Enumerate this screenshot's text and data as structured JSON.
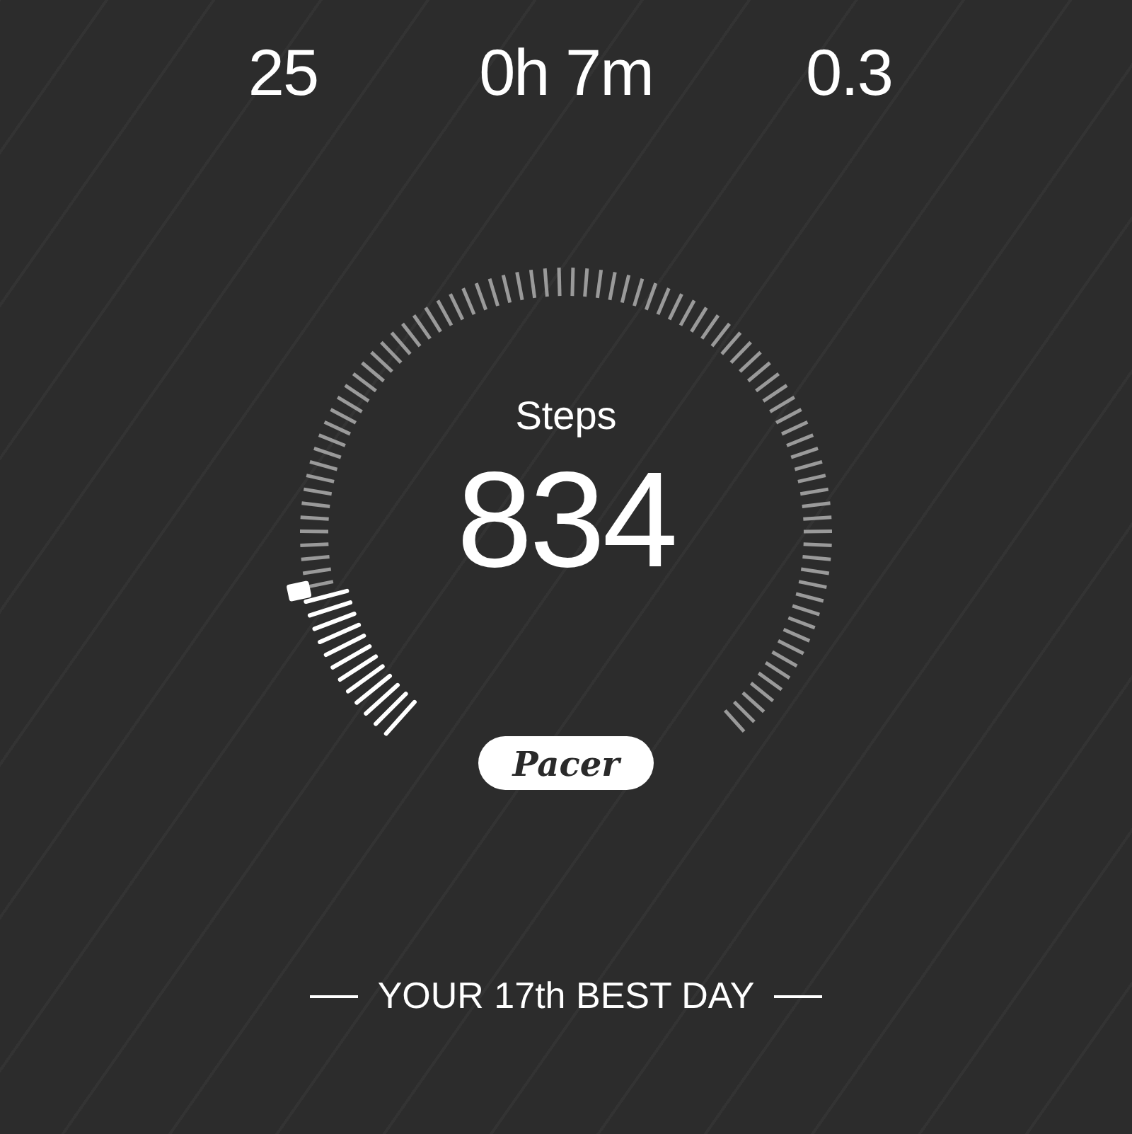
{
  "stats": [
    {
      "value": "25"
    },
    {
      "value": "0h 7m"
    },
    {
      "value": "0.3"
    }
  ],
  "gauge": {
    "label": "Steps",
    "value": "834"
  },
  "badge": {
    "text": "Pacer"
  },
  "footer": {
    "text": "YOUR 17th BEST DAY"
  }
}
